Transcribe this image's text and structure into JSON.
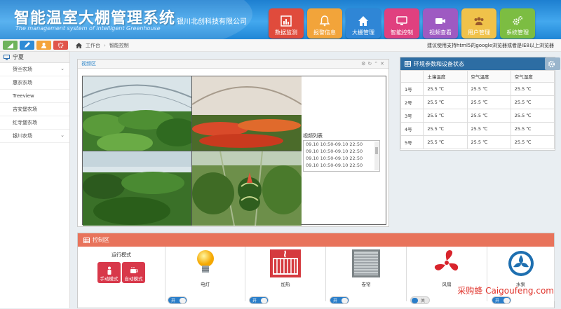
{
  "header": {
    "title": "智能温室大棚管理系统",
    "subtitle": "The management system of intelligent Greenhouse",
    "company": "银川北创科技有限公司"
  },
  "nav": [
    {
      "label": "数据监测",
      "icon": "bar-chart-icon",
      "color": "#e04b3c"
    },
    {
      "label": "报警信息",
      "icon": "bell-icon",
      "color": "#f2a43a"
    },
    {
      "label": "大棚管理",
      "icon": "home-icon",
      "color": "#2f86d6"
    },
    {
      "label": "智能控制",
      "icon": "monitor-icon",
      "color": "#e0407f"
    },
    {
      "label": "视频查看",
      "icon": "video-icon",
      "color": "#9e5ac2"
    },
    {
      "label": "用户管理",
      "icon": "users-icon",
      "color": "#f0c24a"
    },
    {
      "label": "系统管理",
      "icon": "gears-icon",
      "color": "#7cbd42"
    }
  ],
  "toolbar_colors": [
    "#6fb35c",
    "#2e8bd6",
    "#f4a43c",
    "#e0554b"
  ],
  "breadcrumb": {
    "home": "工作台",
    "current": "智能控制",
    "note": "建议使用支持html5的google浏览器或者是IE8以上浏览器"
  },
  "sidebar": {
    "header": "宁夏",
    "items": [
      {
        "label": "贺兰农场",
        "expandable": true
      },
      {
        "label": "惠农农场",
        "expandable": false
      },
      {
        "label": "Treeview",
        "expandable": false
      },
      {
        "label": "吉安堡农场",
        "expandable": false
      },
      {
        "label": "红寺堡农场",
        "expandable": false
      },
      {
        "label": "银川农场",
        "expandable": true
      }
    ]
  },
  "video": {
    "title": "视频区",
    "list_title": "视频列表",
    "list": [
      "09.10 10:50-09.10 22:50",
      "09.10 10:50-09.10 22:50",
      "09.10 10:50-09.10 22:50",
      "09.10 10:50-09.10 22:50"
    ]
  },
  "env": {
    "title": "环境参数和设备状态",
    "columns": [
      "",
      "土壤温度",
      "空气温度",
      "空气湿度"
    ],
    "rows": [
      [
        "1号",
        "25.5 ℃",
        "25.5 ℃",
        "25.5 ℃"
      ],
      [
        "2号",
        "25.5 ℃",
        "25.5 ℃",
        "25.5 ℃"
      ],
      [
        "3号",
        "25.5 ℃",
        "25.5 ℃",
        "25.5 ℃"
      ],
      [
        "4号",
        "25.5 ℃",
        "25.5 ℃",
        "25.5 ℃"
      ],
      [
        "5号",
        "25.5 ℃",
        "25.5 ℃",
        "25.5 ℃"
      ]
    ]
  },
  "control": {
    "title": "控制区",
    "mode_label": "运行模式",
    "manual": "手动模式",
    "auto": "自动模式",
    "devices": [
      {
        "label": "电灯",
        "icon": "lightbulb-icon",
        "switch": "开",
        "on": true
      },
      {
        "label": "加热",
        "icon": "heater-icon",
        "switch": "开",
        "on": true
      },
      {
        "label": "卷帘",
        "icon": "shutter-icon",
        "switch": "开",
        "on": true
      },
      {
        "label": "风扇",
        "icon": "fan-icon",
        "switch": "关",
        "on": false
      },
      {
        "label": "水泵",
        "icon": "pump-icon",
        "switch": "开",
        "on": true
      }
    ]
  },
  "watermark": "采购蜂 Caigoufeng.com"
}
